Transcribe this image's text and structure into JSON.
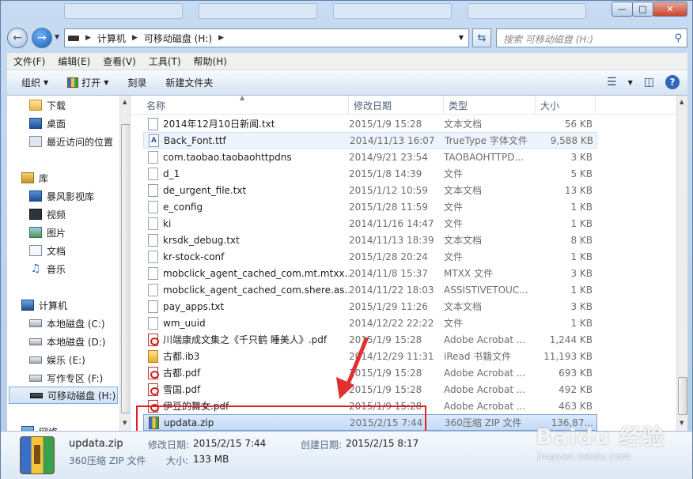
{
  "address": {
    "crumbs": [
      "计算机",
      "可移动磁盘 (H:)"
    ],
    "search_placeholder": "搜索 可移动磁盘 (H:)"
  },
  "menu": [
    "文件(F)",
    "编辑(E)",
    "查看(V)",
    "工具(T)",
    "帮助(H)"
  ],
  "commands": {
    "organize": "组织",
    "open": "打开",
    "burn": "刻录",
    "new_folder": "新建文件夹"
  },
  "nav": [
    {
      "label": "下载",
      "icon": "download-folder-icon"
    },
    {
      "label": "桌面",
      "icon": "desktop-icon"
    },
    {
      "label": "最近访问的位置",
      "icon": "recent-places-icon"
    },
    {
      "label": "库",
      "icon": "library-icon"
    },
    {
      "label": "暴风影视库",
      "icon": "video-library-icon"
    },
    {
      "label": "视频",
      "icon": "video-icon"
    },
    {
      "label": "图片",
      "icon": "picture-icon"
    },
    {
      "label": "文档",
      "icon": "document-icon"
    },
    {
      "label": "音乐",
      "icon": "music-icon"
    },
    {
      "label": "计算机",
      "icon": "computer-icon"
    },
    {
      "label": "本地磁盘 (C:)",
      "icon": "system-drive-icon"
    },
    {
      "label": "本地磁盘 (D:)",
      "icon": "drive-icon"
    },
    {
      "label": "娱乐 (E:)",
      "icon": "drive-icon"
    },
    {
      "label": "写作专区 (F:)",
      "icon": "drive-icon"
    },
    {
      "label": "可移动磁盘 (H:)",
      "icon": "usb-drive-icon"
    },
    {
      "label": "网络",
      "icon": "network-icon"
    }
  ],
  "columns": {
    "name": "名称",
    "date": "修改日期",
    "type": "类型",
    "size": "大小"
  },
  "files": [
    {
      "name": "2014年12月10日新闻.txt",
      "date": "2015/1/9 15:28",
      "type": "文本文档",
      "size": "56 KB",
      "icon": "txt"
    },
    {
      "name": "Back_Font.ttf",
      "date": "2014/11/13 16:07",
      "type": "TrueType 字体文件",
      "size": "9,588 KB",
      "icon": "ttf"
    },
    {
      "name": "com.taobao.taobaohttpdns",
      "date": "2014/9/21 23:54",
      "type": "TAOBAOHTTPD...",
      "size": "3 KB",
      "icon": "blank"
    },
    {
      "name": "d_1",
      "date": "2015/1/8 14:39",
      "type": "文件",
      "size": "5 KB",
      "icon": "blank"
    },
    {
      "name": "de_urgent_file.txt",
      "date": "2015/1/12 10:59",
      "type": "文本文档",
      "size": "13 KB",
      "icon": "txt"
    },
    {
      "name": "e_config",
      "date": "2015/1/28 11:59",
      "type": "文件",
      "size": "1 KB",
      "icon": "blank"
    },
    {
      "name": "ki",
      "date": "2014/11/16 14:47",
      "type": "文件",
      "size": "1 KB",
      "icon": "blank"
    },
    {
      "name": "krsdk_debug.txt",
      "date": "2014/11/13 18:39",
      "type": "文本文档",
      "size": "8 KB",
      "icon": "txt"
    },
    {
      "name": "kr-stock-conf",
      "date": "2015/1/28 20:24",
      "type": "文件",
      "size": "1 KB",
      "icon": "blank"
    },
    {
      "name": "mobclick_agent_cached_com.mt.mtxx....",
      "date": "2014/11/8 15:37",
      "type": "MTXX 文件",
      "size": "3 KB",
      "icon": "blank"
    },
    {
      "name": "mobclick_agent_cached_com.shere.as...",
      "date": "2014/11/22 18:03",
      "type": "ASSISTIVETOUC...",
      "size": "1 KB",
      "icon": "blank"
    },
    {
      "name": "pay_apps.txt",
      "date": "2015/1/29 11:26",
      "type": "文本文档",
      "size": "3 KB",
      "icon": "txt"
    },
    {
      "name": "wm_uuid",
      "date": "2014/12/22 22:22",
      "type": "文件",
      "size": "1 KB",
      "icon": "blank"
    },
    {
      "name": "川端康成文集之《千只鹤 睡美人》.pdf",
      "date": "2015/1/9 15:28",
      "type": "Adobe Acrobat ...",
      "size": "1,244 KB",
      "icon": "pdf"
    },
    {
      "name": "古都.ib3",
      "date": "2014/12/29 11:31",
      "type": "iRead 书籍文件",
      "size": "11,193 KB",
      "icon": "ib3"
    },
    {
      "name": "古都.pdf",
      "date": "2015/1/9 15:28",
      "type": "Adobe Acrobat ...",
      "size": "693 KB",
      "icon": "pdf"
    },
    {
      "name": "雪国.pdf",
      "date": "2015/1/9 15:28",
      "type": "Adobe Acrobat ...",
      "size": "492 KB",
      "icon": "pdf"
    },
    {
      "name": "伊豆的舞女.pdf",
      "date": "2015/1/9 15:28",
      "type": "Adobe Acrobat ...",
      "size": "463 KB",
      "icon": "pdf"
    },
    {
      "name": "updata.zip",
      "date": "2015/2/15 7:44",
      "type": "360压缩 ZIP 文件",
      "size": "136,87...",
      "icon": "zip"
    }
  ],
  "details": {
    "filename": "updata.zip",
    "filetype": "360压缩 ZIP 文件",
    "modified_label": "修改日期:",
    "modified_value": "2015/2/15 7:44",
    "created_label": "创建日期:",
    "created_value": "2015/2/15 8:17",
    "size_label": "大小:",
    "size_value": "133 MB"
  },
  "watermark": {
    "logo": "Baidu 经验",
    "sub": "jingyan.baidu.com"
  },
  "colors": {
    "accent": "#3a6fc9",
    "annotation": "#e02020"
  }
}
